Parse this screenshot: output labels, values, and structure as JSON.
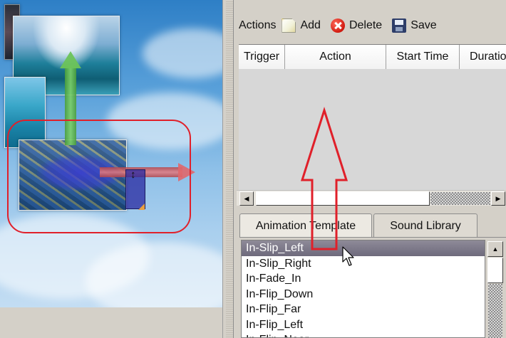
{
  "toolbar": {
    "title": "Actions",
    "add_label": "Add",
    "delete_label": "Delete",
    "save_label": "Save"
  },
  "table": {
    "columns": [
      "Trigger",
      "Action",
      "Start Time",
      "Duratio"
    ]
  },
  "tabs": [
    "Animation Template",
    "Sound Library"
  ],
  "animation_list": {
    "selected": "In-Slip_Left",
    "items": [
      "In-Slip_Left",
      "In-Slip_Right",
      "In-Fade_In",
      "In-Flip_Down",
      "In-Flip_Far",
      "In-Flip_Left",
      "In-Flip_Near"
    ]
  },
  "icons": {
    "add": "new-page-icon",
    "delete": "delete-icon",
    "save": "save-disk-icon"
  },
  "colors": {
    "annotation_red": "#e0202a",
    "panel_gray": "#d4d0c8",
    "selection_highlight": "#7c7889"
  }
}
